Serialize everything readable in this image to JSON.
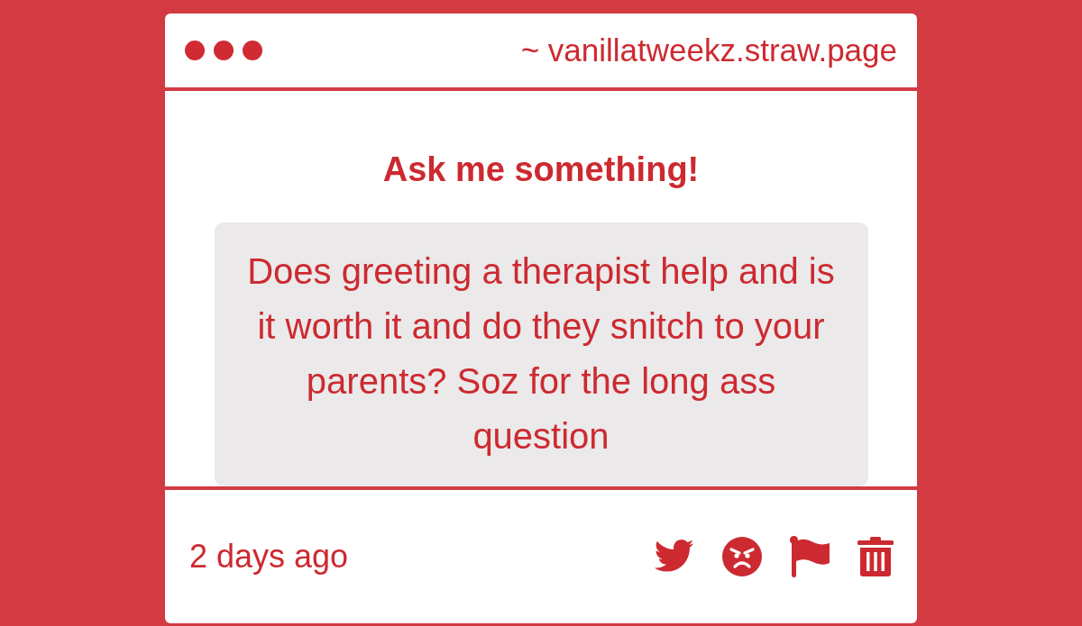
{
  "address_bar": {
    "url": "~ vanillatweekz.straw.page"
  },
  "prompt": {
    "title": "Ask me something!"
  },
  "question": {
    "text": "Does greeting a therapist help and is it worth it and do they snitch to your parents? Soz for the long ass question"
  },
  "footer": {
    "time": "2 days ago",
    "actions": [
      {
        "kind": "twitter"
      },
      {
        "kind": "angry"
      },
      {
        "kind": "flag"
      },
      {
        "kind": "delete"
      }
    ]
  }
}
